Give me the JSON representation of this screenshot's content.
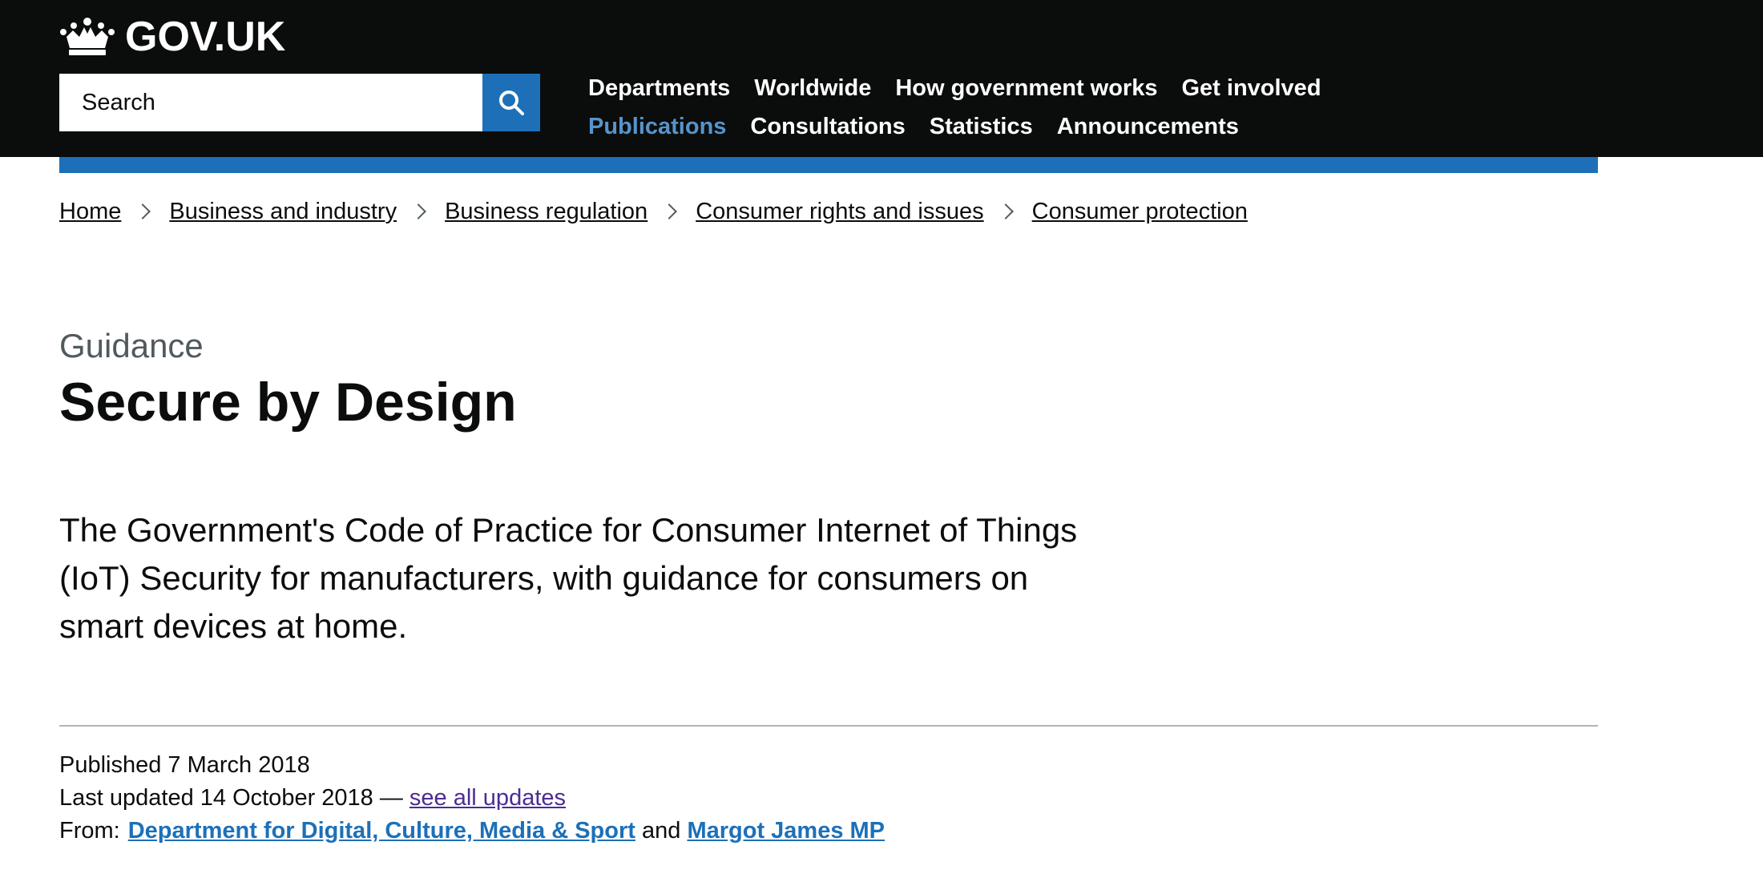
{
  "header": {
    "logo_text": "GOV.UK",
    "search": {
      "placeholder": "Search"
    },
    "nav_row1": [
      {
        "label": "Departments"
      },
      {
        "label": "Worldwide"
      },
      {
        "label": "How government works"
      },
      {
        "label": "Get involved"
      }
    ],
    "nav_row2": [
      {
        "label": "Publications",
        "active": true
      },
      {
        "label": "Consultations"
      },
      {
        "label": "Statistics"
      },
      {
        "label": "Announcements"
      }
    ]
  },
  "breadcrumbs": [
    {
      "label": "Home"
    },
    {
      "label": "Business and industry"
    },
    {
      "label": "Business regulation"
    },
    {
      "label": "Consumer rights and issues"
    },
    {
      "label": "Consumer protection"
    }
  ],
  "page": {
    "caption": "Guidance",
    "title": "Secure by Design",
    "lead": "The Government's Code of Practice for Consumer Internet of Things (IoT) Security for manufacturers, with guidance for consumers on smart devices at home."
  },
  "metadata": {
    "published": "Published 7 March 2018",
    "updated": "Last updated 14 October 2018 — ",
    "see_updates": "see all updates",
    "from_label": "From:",
    "from_org": "Department for Digital, Culture, Media & Sport",
    "and_text": " and ",
    "from_person": "Margot James MP"
  },
  "colors": {
    "header_bg": "#0b0c0c",
    "brand_blue": "#1d70b8",
    "active_nav": "#5694ca",
    "visited_link": "#4c2c92",
    "caption_grey": "#505a5f",
    "divider": "#b1b4b6"
  },
  "icons": {
    "logo": "crown-icon",
    "search_button": "search-icon",
    "breadcrumb_separator": "chevron-right-icon"
  }
}
